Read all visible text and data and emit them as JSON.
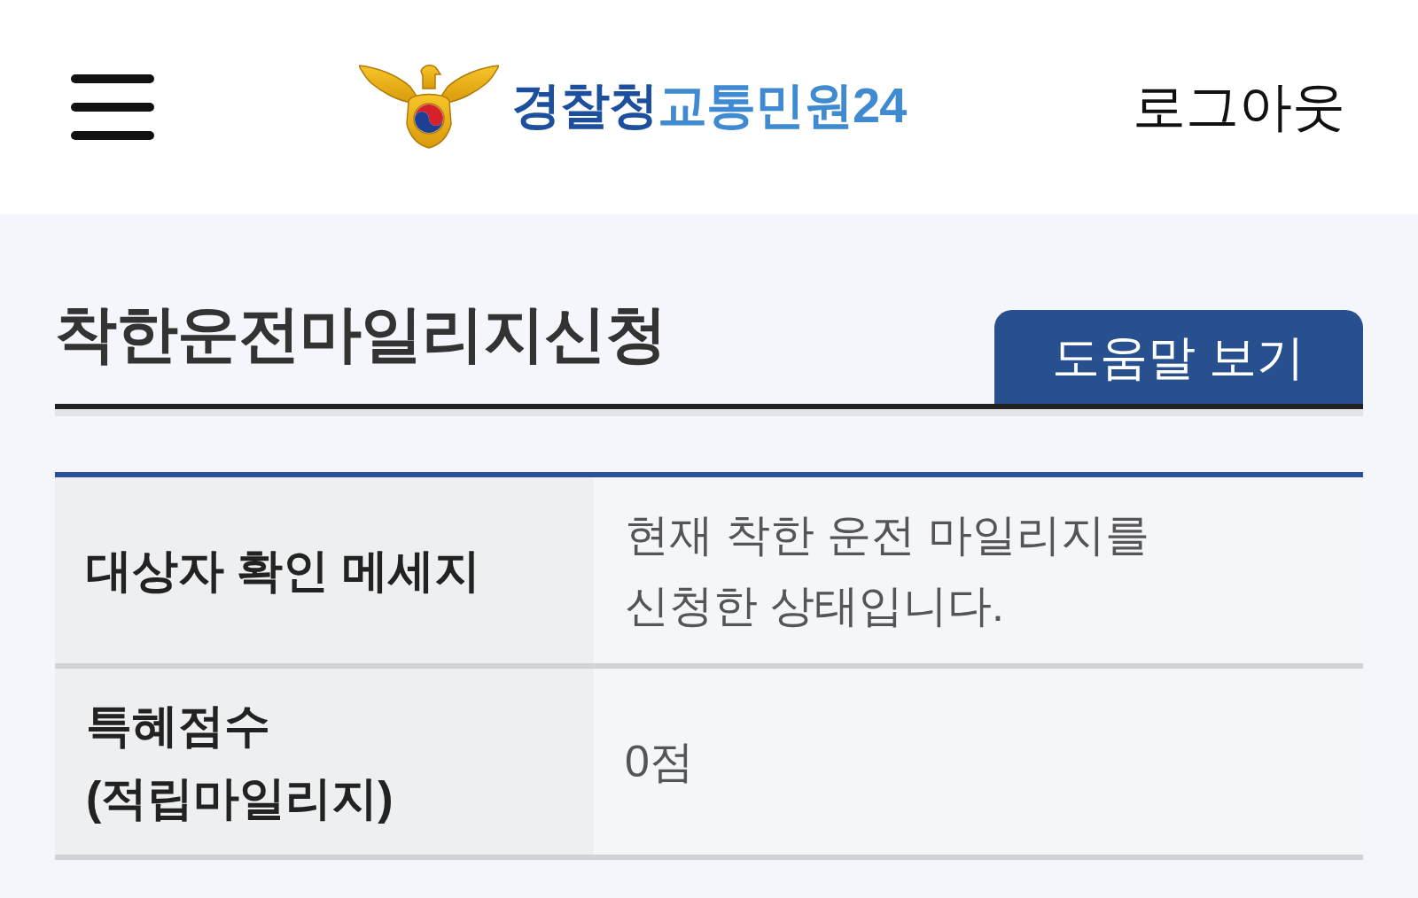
{
  "header": {
    "logo": {
      "text_primary": "경찰청",
      "text_secondary": "교통민원24"
    },
    "logout_link": "로그아웃"
  },
  "page_title": "착한운전마일리지신청",
  "help_button": "도움말 보기",
  "info_table": {
    "rows": [
      {
        "label": "대상자 확인 메세지",
        "value": "현재 착한 운전 마일리지를 신청한 상태입니다."
      },
      {
        "label": "특혜점수 (적립마일리지)",
        "value": "0점"
      }
    ]
  }
}
